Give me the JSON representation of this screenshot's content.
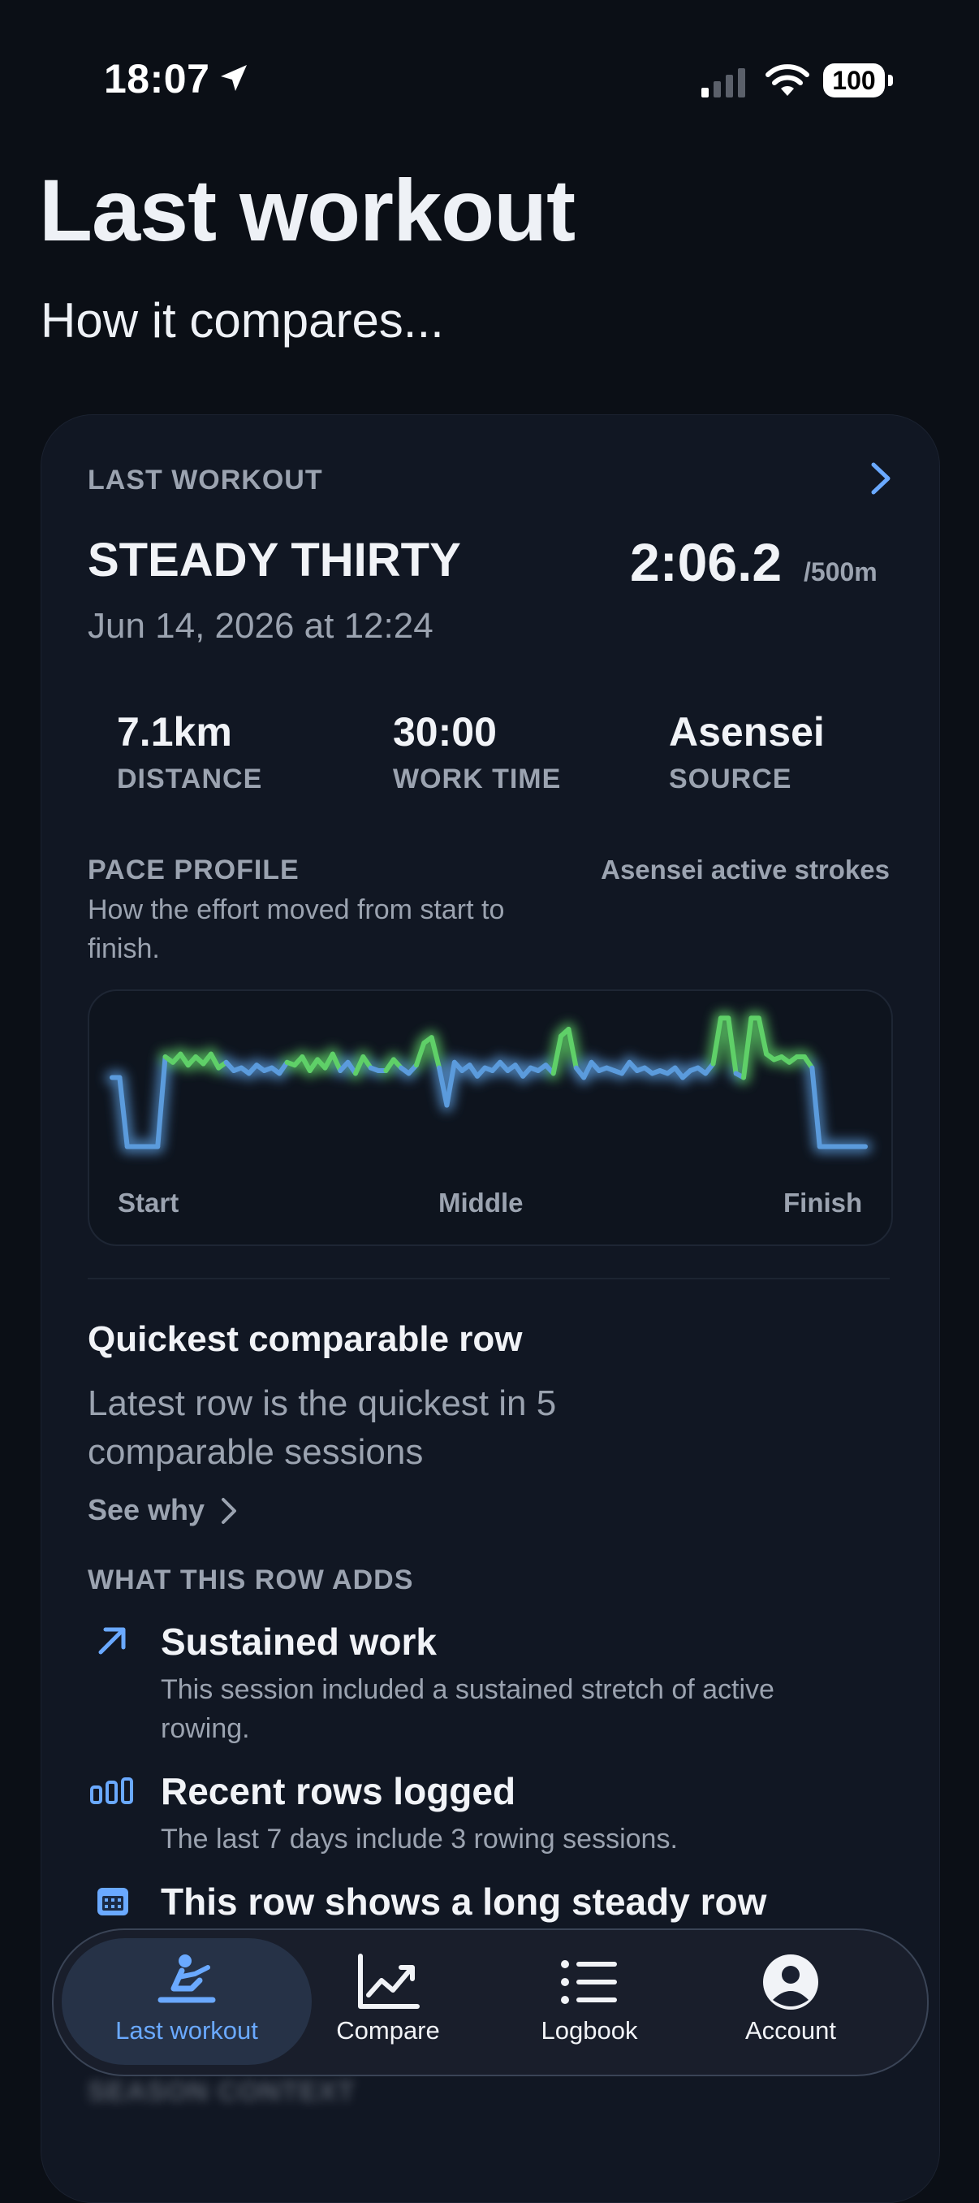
{
  "status_bar": {
    "time": "18:07",
    "battery": "100"
  },
  "page": {
    "title": "Last workout",
    "subtitle": "How it compares..."
  },
  "card": {
    "header_label": "LAST WORKOUT",
    "workout_name": "STEADY THIRTY",
    "date": "Jun 14, 2026 at 12:24",
    "pace": "2:06.2",
    "pace_unit": "/500m",
    "stats": [
      {
        "value": "7.1km",
        "label": "DISTANCE"
      },
      {
        "value": "30:00",
        "label": "WORK TIME"
      },
      {
        "value": "Asensei",
        "label": "SOURCE"
      }
    ],
    "pace_profile": {
      "title": "PACE PROFILE",
      "description": "How the effort moved from start to finish.",
      "source_note": "Asensei active strokes",
      "axis_labels": [
        "Start",
        "Middle",
        "Finish"
      ]
    },
    "quickest": {
      "title": "Quickest comparable row",
      "description": "Latest row is the quickest in 5 comparable sessions",
      "link": "See why"
    },
    "adds": {
      "title": "WHAT THIS ROW ADDS",
      "items": [
        {
          "icon": "arrow-up-right-icon",
          "title": "Sustained work",
          "description": "This session included a sustained stretch of active rowing."
        },
        {
          "icon": "bars-icon",
          "title": "Recent rows logged",
          "description": "The last 7 days include 3 rowing sessions."
        },
        {
          "icon": "calendar-icon",
          "title": "This row shows a long steady row",
          "description": ""
        }
      ]
    },
    "season_context_label": "SEASON CONTEXT"
  },
  "tabs": [
    {
      "label": "Last workout",
      "icon": "rower-icon",
      "active": true
    },
    {
      "label": "Compare",
      "icon": "trend-chart-icon",
      "active": false
    },
    {
      "label": "Logbook",
      "icon": "list-icon",
      "active": false
    },
    {
      "label": "Account",
      "icon": "person-circle-icon",
      "active": false
    }
  ],
  "colors": {
    "accent": "#6aa9ff",
    "pace_fast": "#5fd068",
    "pace_normal": "#5b9bdc",
    "background": "#0b0f16",
    "card": "#111723"
  },
  "chart_data": {
    "type": "line",
    "title": "PACE PROFILE",
    "xlabel": "",
    "ylabel": "",
    "x_tick_labels": [
      "Start",
      "Middle",
      "Finish"
    ],
    "xlim": [
      0,
      100
    ],
    "ylim": [
      0,
      1
    ],
    "note": "relative effort along the session (higher = faster); green where above usual effort",
    "series": [
      {
        "values": [
          0.55,
          0.55,
          0.05,
          0.05,
          0.05,
          0.05,
          0.05,
          0.7,
          0.66,
          0.72,
          0.64,
          0.7,
          0.65,
          0.72,
          0.62,
          0.66,
          0.6,
          0.62,
          0.58,
          0.64,
          0.6,
          0.62,
          0.58,
          0.66,
          0.64,
          0.7,
          0.6,
          0.68,
          0.62,
          0.72,
          0.6,
          0.66,
          0.58,
          0.7,
          0.62,
          0.6,
          0.6,
          0.68,
          0.62,
          0.58,
          0.64,
          0.8,
          0.84,
          0.62,
          0.35,
          0.66,
          0.6,
          0.64,
          0.56,
          0.62,
          0.6,
          0.66,
          0.6,
          0.64,
          0.56,
          0.62,
          0.6,
          0.64,
          0.58,
          0.85,
          0.9,
          0.62,
          0.55,
          0.66,
          0.6,
          0.62,
          0.6,
          0.58,
          0.66,
          0.6,
          0.62,
          0.58,
          0.6,
          0.58,
          0.62,
          0.55,
          0.6,
          0.62,
          0.58,
          0.65,
          0.98,
          0.98,
          0.58,
          0.55,
          0.98,
          0.98,
          0.72,
          0.68,
          0.7,
          0.66,
          0.7,
          0.7,
          0.62,
          0.05,
          0.05,
          0.05,
          0.05,
          0.05,
          0.05,
          0.05
        ]
      }
    ]
  }
}
